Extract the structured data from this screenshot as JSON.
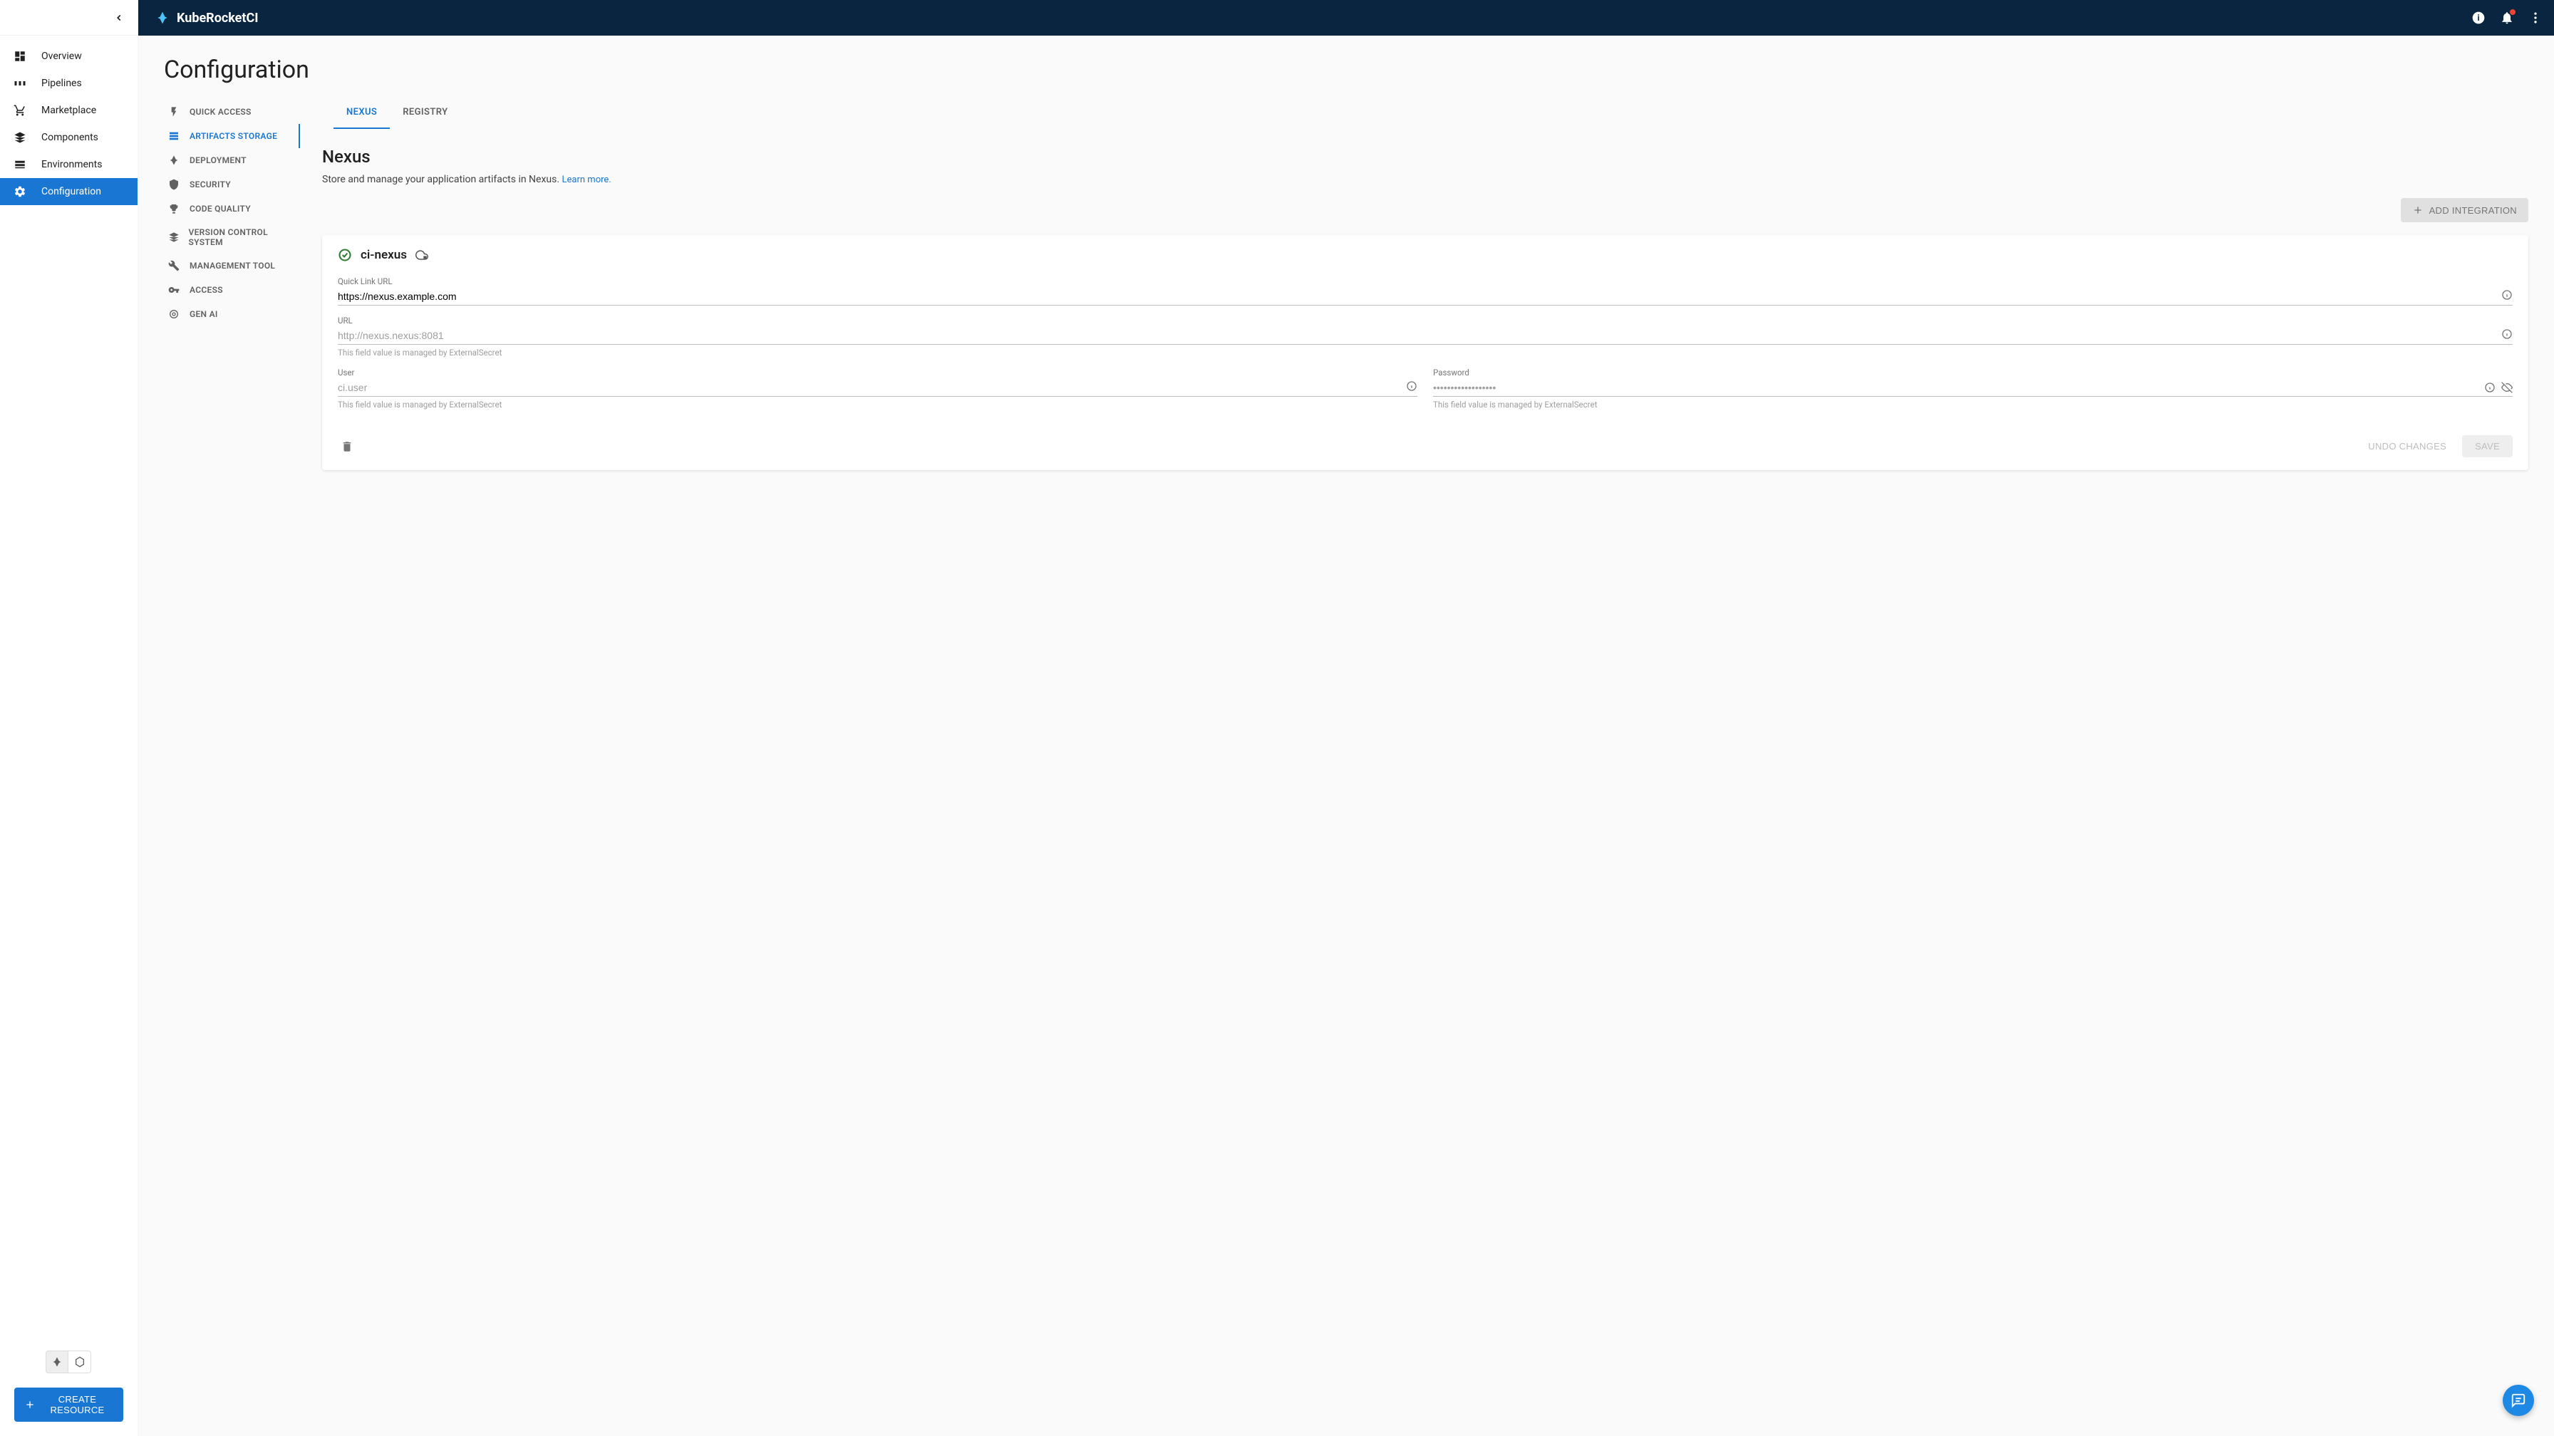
{
  "brand": "KubeRocketCI",
  "sidebar": {
    "items": [
      {
        "label": "Overview"
      },
      {
        "label": "Pipelines"
      },
      {
        "label": "Marketplace"
      },
      {
        "label": "Components"
      },
      {
        "label": "Environments"
      },
      {
        "label": "Configuration"
      }
    ],
    "create_label": "CREATE RESOURCE"
  },
  "page": {
    "title": "Configuration"
  },
  "subnav": {
    "items": [
      {
        "label": "QUICK ACCESS"
      },
      {
        "label": "ARTIFACTS STORAGE"
      },
      {
        "label": "DEPLOYMENT"
      },
      {
        "label": "SECURITY"
      },
      {
        "label": "CODE QUALITY"
      },
      {
        "label": "VERSION CONTROL SYSTEM"
      },
      {
        "label": "MANAGEMENT TOOL"
      },
      {
        "label": "ACCESS"
      },
      {
        "label": "GEN AI"
      }
    ]
  },
  "tabs": [
    {
      "label": "NEXUS"
    },
    {
      "label": "REGISTRY"
    }
  ],
  "section": {
    "title": "Nexus",
    "desc": "Store and manage your application artifacts in Nexus.",
    "learn_more": "Learn more.",
    "add_label": "ADD INTEGRATION"
  },
  "integration": {
    "name": "ci-nexus",
    "quick_link": {
      "label": "Quick Link URL",
      "value": "https://nexus.example.com"
    },
    "url": {
      "label": "URL",
      "value": "http://nexus.nexus:8081",
      "helper": "This field value is managed by ExternalSecret"
    },
    "user": {
      "label": "User",
      "value": "ci.user",
      "helper": "This field value is managed by ExternalSecret"
    },
    "password": {
      "label": "Password",
      "value": "••••••••••••••••••",
      "helper": "This field value is managed by ExternalSecret"
    },
    "undo_label": "UNDO CHANGES",
    "save_label": "SAVE"
  }
}
